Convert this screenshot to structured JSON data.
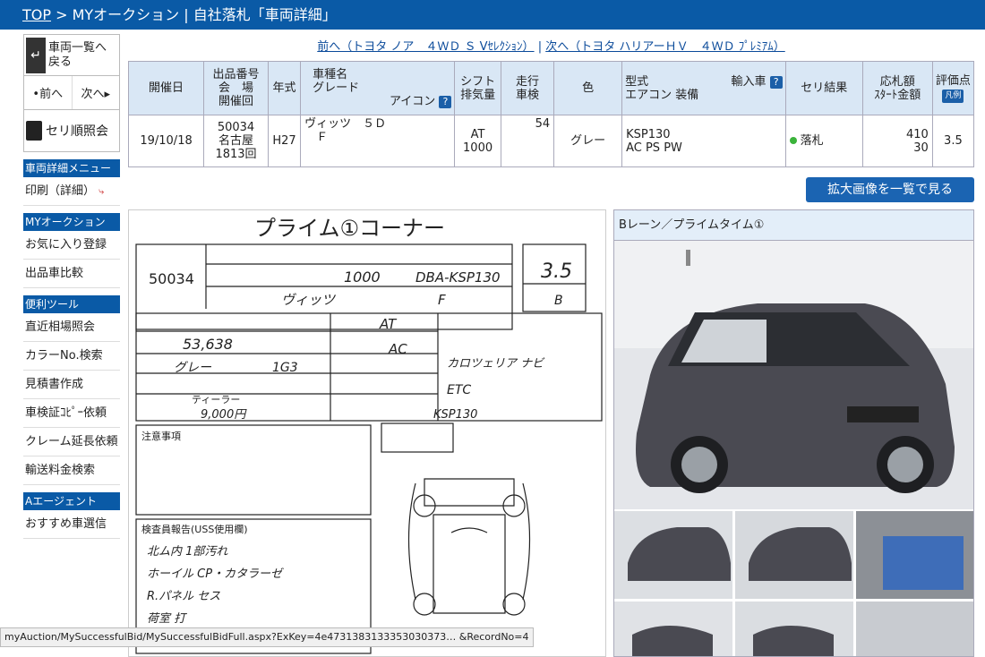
{
  "header": {
    "top": "TOP",
    "rest": " > MYオークション | 自社落札「車両詳細」"
  },
  "sidebar": {
    "back": "車両一覧へ\n戻る",
    "prev": "•前へ",
    "next": "次へ▸",
    "seri": "セリ順照会",
    "menu_head": "車両詳細メニュー",
    "print": "印刷（詳細）",
    "my_head": "MYオークション",
    "favorites": "お気に入り登録",
    "compare": "出品車比較",
    "tools_head": "便利ツール",
    "market": "直近相場照会",
    "color": "カラーNo.検索",
    "estimate": "見積書作成",
    "certificate": "車検証ｺﾋﾟｰ依頼",
    "claim": "クレーム延長依頼",
    "shipping": "輸送料金検索",
    "agent_head": "Aエージェント",
    "recommend": "おすすめ車選信"
  },
  "nav": {
    "prev_link": "前へ（トヨタ ノア　４ＷＤ Ｓ Vｾﾚｸｼｮﾝ）",
    "separator": " | ",
    "next_link": "次へ（トヨタ ハリアーＨＶ　４ＷＤ ﾌﾟﾚﾐｱﾑ）"
  },
  "table": {
    "headers": {
      "date": "開催日",
      "lot": "出品番号\n会　場\n開催回",
      "year": "年式",
      "name": "車種名\nグレード",
      "icon": "アイコン",
      "shift": "シフト\n排気量",
      "mileage": "走行\n車検",
      "color": "色",
      "model": "型式\nエアコン 装備",
      "import": "輸入車",
      "result": "セリ結果",
      "bid": "応札額\nｽﾀｰﾄ金額",
      "score": "評価点",
      "legend": "凡例"
    },
    "row": {
      "date": "19/10/18",
      "lot": "50034\n名古屋\n1813回",
      "year": "H27",
      "name": "ヴィッツ　５Ｄ\n　Ｆ",
      "shift": "AT\n1000",
      "mileage": "54",
      "color": "グレー",
      "model": "KSP130\nAC PS PW",
      "result": "落札",
      "bid": "410\n30",
      "score": "3.5"
    }
  },
  "enlarge": "拡大画像を一覧で見る",
  "sheet": {
    "title": "プライム①コーナー",
    "lot": "50034",
    "model_code": "DBA-KSP130",
    "cc": "1000",
    "score": "3.5",
    "grade_letter": "B",
    "grade": "F",
    "name": "ヴィッツ",
    "mileage": "53,638",
    "shift": "AT",
    "ac": "AC",
    "color": "グレー",
    "color_no": "1G3",
    "points": "カロツェリア ナビ",
    "etc": "ETC",
    "recycle": "9,000円",
    "frame": "KSP130",
    "dealer": "ティーラー",
    "notes_head": "注意事項",
    "inspect_head": "検査員報告(USS使用欄)"
  },
  "photos": {
    "title": "Bレーン／プライムタイム①"
  },
  "status": "myAuction/MySuccessfulBid/MySuccessfulBidFull.aspx?ExKey=4e4731383133353030373… &RecordNo=4",
  "colors": {
    "brand": "#0a5aa6",
    "header_cell": "#d9e7f5",
    "car": "#4a4a52"
  }
}
